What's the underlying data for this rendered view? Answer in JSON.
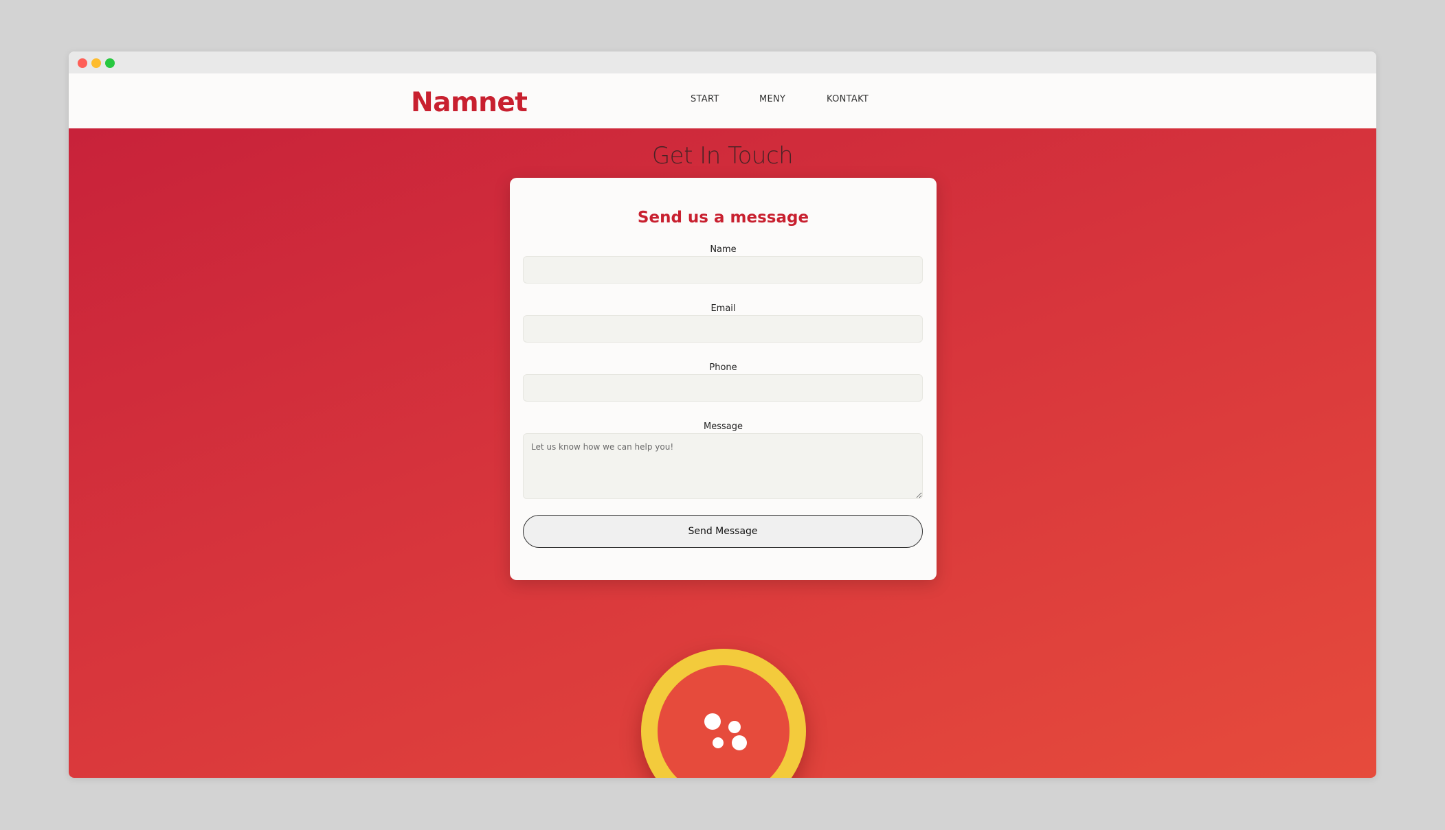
{
  "navbar": {
    "brand": "Namnet",
    "links": [
      {
        "label": "START"
      },
      {
        "label": "MENY"
      },
      {
        "label": "KONTAKT"
      }
    ]
  },
  "contact": {
    "section_title": "Get In Touch",
    "card_title": "Send us a message",
    "fields": {
      "name": {
        "label": "Name",
        "value": ""
      },
      "email": {
        "label": "Email",
        "value": ""
      },
      "phone": {
        "label": "Phone",
        "value": ""
      },
      "message": {
        "label": "Message",
        "placeholder": "Let us know how we can help you!",
        "value": ""
      }
    },
    "submit_label": "Send Message"
  },
  "badge": {
    "icon": "logo-dots-icon"
  },
  "colors": {
    "brand": "#c8202f",
    "hero_start": "#c8223a",
    "hero_end": "#e64b3c",
    "badge_ring": "#f3cb3c",
    "badge_fill": "#e64b3c"
  }
}
